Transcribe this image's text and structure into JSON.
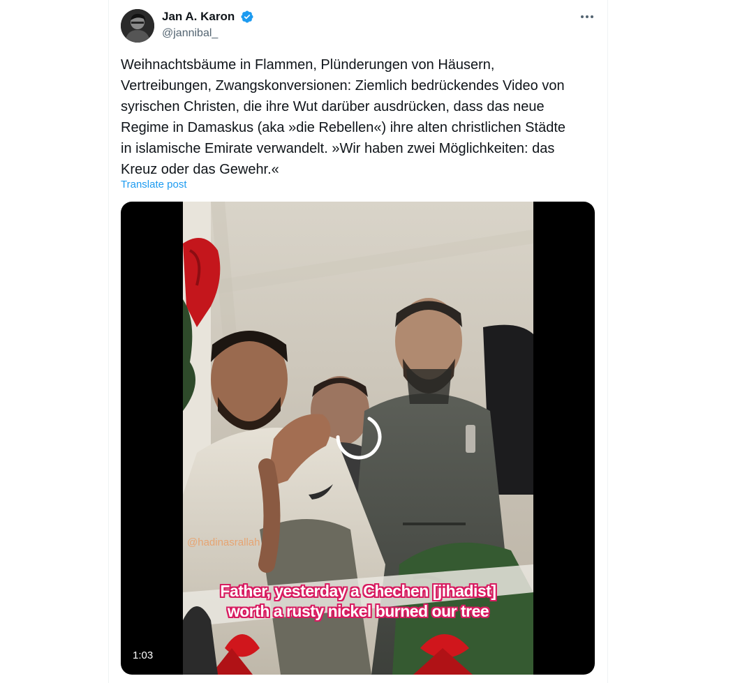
{
  "post": {
    "author_name": "Jan A. Karon",
    "handle": "@jannibal_",
    "verified_icon": "verified-badge-icon",
    "more_icon": "more-horizontal-icon",
    "text": "Weihnachtsbäume in Flammen, Plünderungen von Häusern,\nVertreibungen, Zwangskonversionen: Ziemlich bedrückendes Video von\nsyrischen Christen, die ihre Wut darüber ausdrücken, dass das neue\nRegime in Damaskus (aka »die Rebellen«) ihre alten christlichen Städte\nin islamische Emirate verwandelt. »Wir haben zwei Möglichkeiten: das\nKreuz oder das Gewehr.«",
    "translate_label": "Translate post"
  },
  "video": {
    "watermark": "@hadinasrallah",
    "caption_line1": "Father, yesterday a Chechen [jihadist]",
    "caption_line2": "worth a rusty nickel burned our tree",
    "duration": "1:03",
    "loading_icon": "loading-spinner-icon"
  },
  "colors": {
    "accent": "#1d9bf0",
    "text_primary": "#0f1419",
    "text_secondary": "#536471",
    "caption_outline": "#d81b60"
  }
}
